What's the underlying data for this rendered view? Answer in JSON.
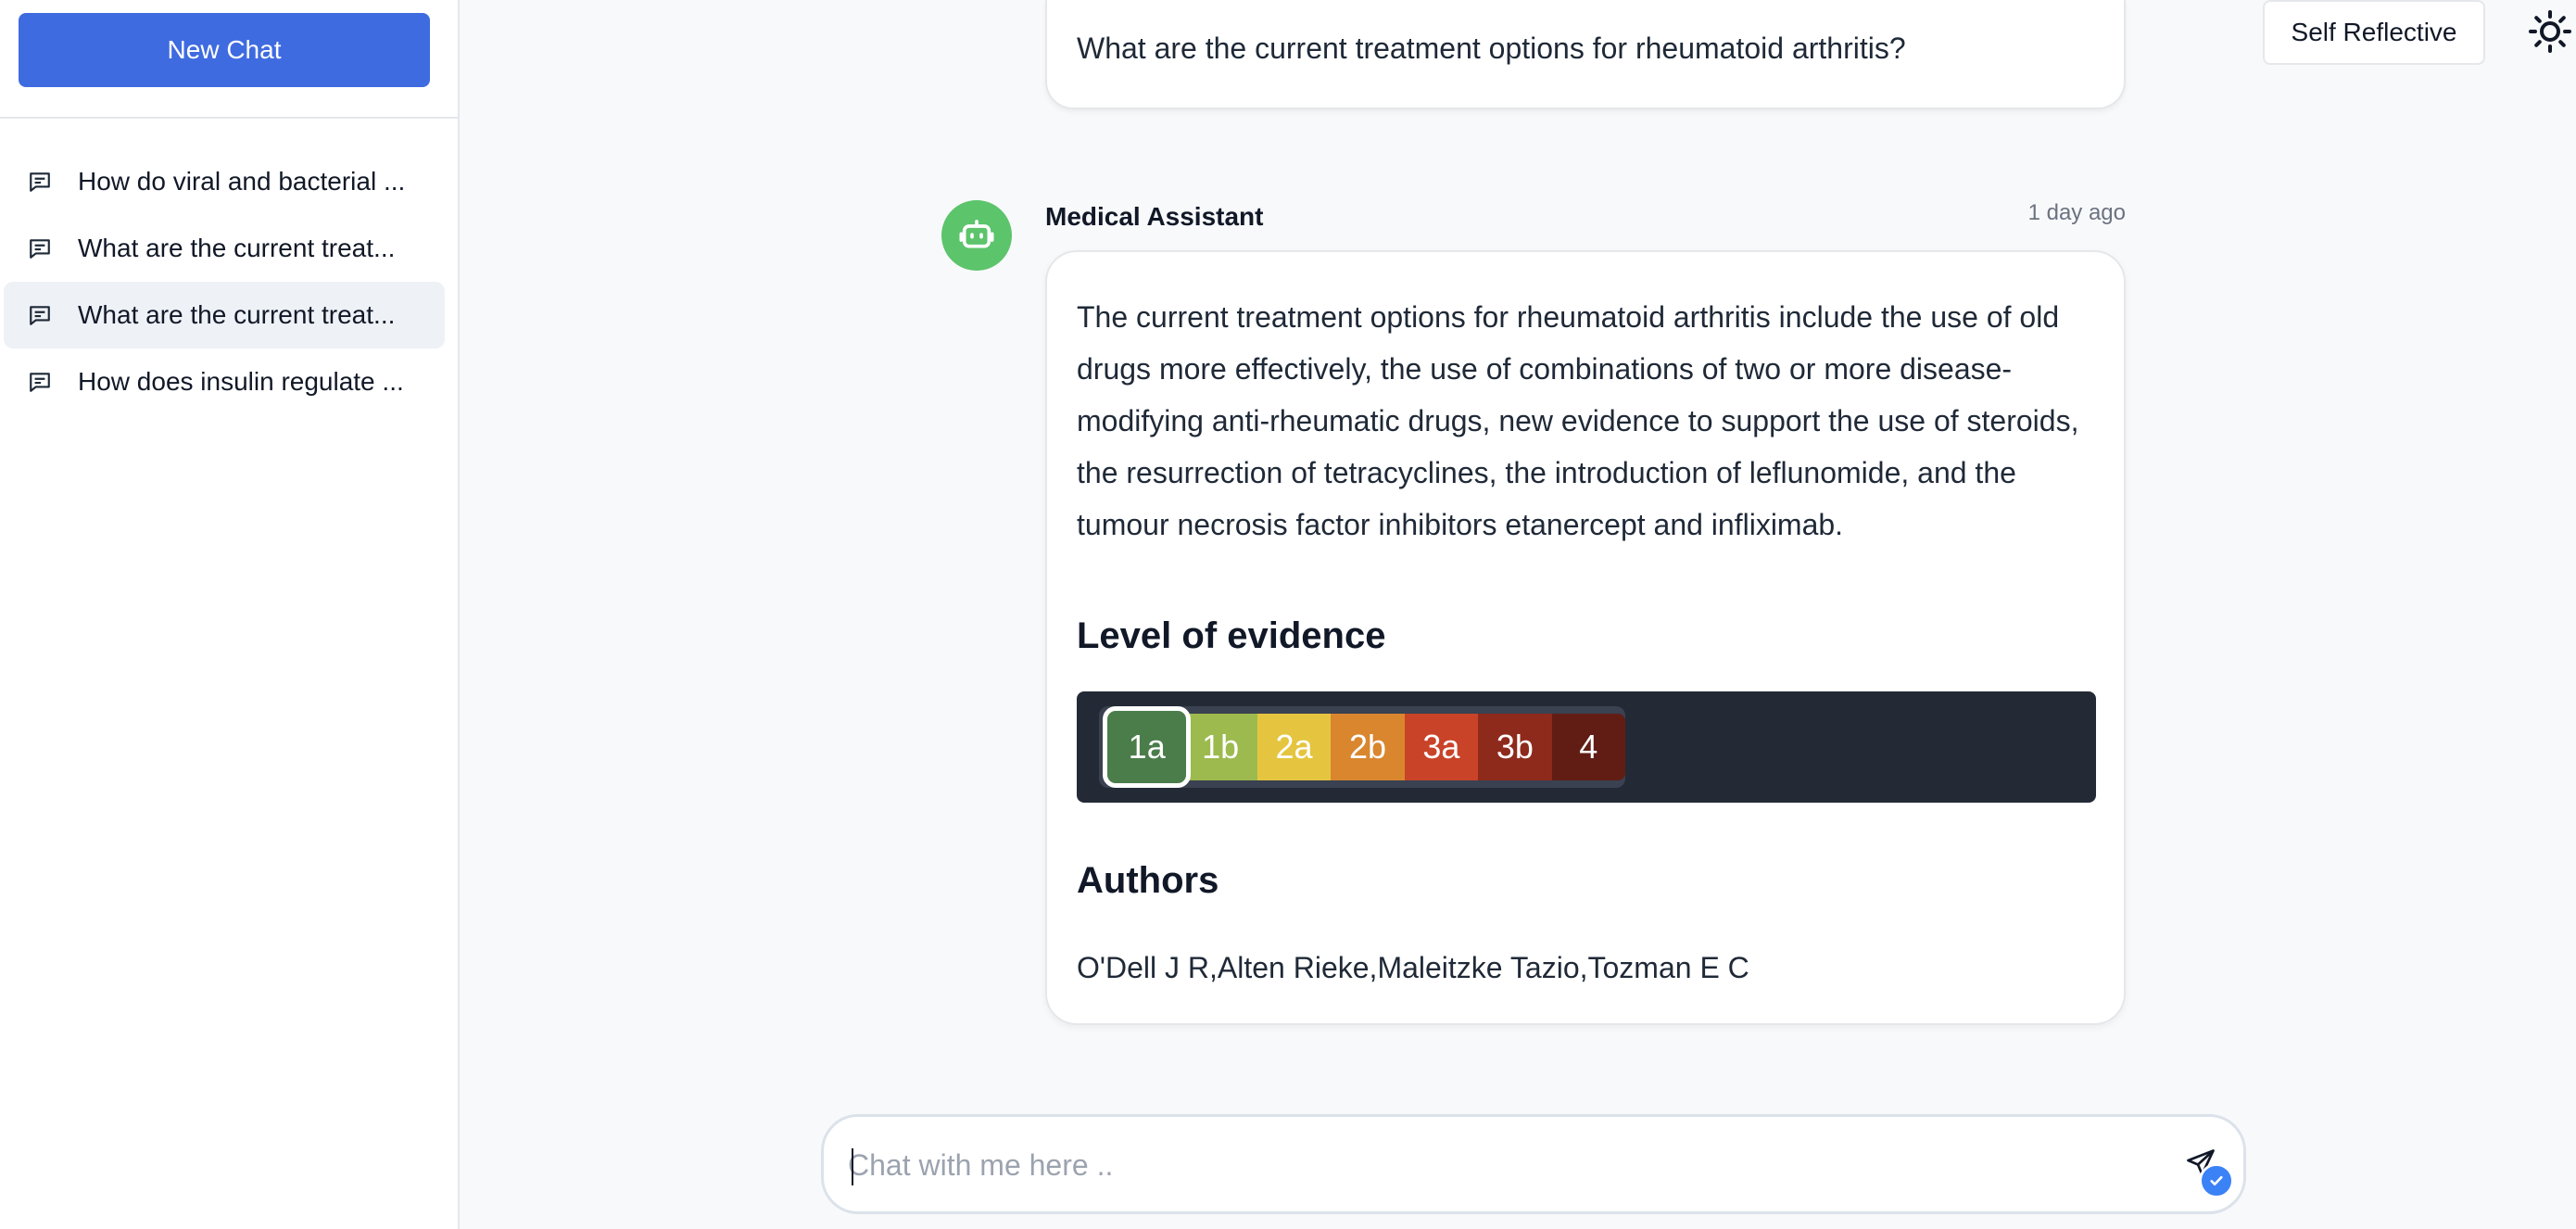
{
  "sidebar": {
    "new_chat_label": "New Chat",
    "history": [
      {
        "title": "How do viral and bacterial ...",
        "icon": "chat-bubble-icon"
      },
      {
        "title": "What are the current treat...",
        "icon": "chat-bubble-icon"
      },
      {
        "title": "What are the current treat...",
        "icon": "chat-bubble-icon",
        "active": true
      },
      {
        "title": "How does insulin regulate ...",
        "icon": "chat-bubble-icon"
      }
    ]
  },
  "header": {
    "mode_label": "Self Reflective",
    "theme_icon": "sun-icon"
  },
  "conversation": {
    "user_question": "What are the current treatment options for rheumatoid arthritis?",
    "assistant": {
      "name": "Medical Assistant",
      "avatar_icon": "robot-icon",
      "timestamp": "1 day ago",
      "answer": "The current treatment options for rheumatoid arthritis include the use of old drugs more effectively, the use of combinations of two or more disease-modifying anti-rheumatic drugs, new evidence to support the use of steroids, the resurrection of tetracyclines, the introduction of leflunomide, and the tumour necrosis factor inhibitors etanercept and infliximab.",
      "evidence_heading": "Level of evidence",
      "evidence_levels": [
        {
          "label": "1a",
          "color": "#4a7d4a"
        },
        {
          "label": "1b",
          "color": "#9cba4e"
        },
        {
          "label": "2a",
          "color": "#e5c53f"
        },
        {
          "label": "2b",
          "color": "#d9862f"
        },
        {
          "label": "3a",
          "color": "#c94328"
        },
        {
          "label": "3b",
          "color": "#8e2a1c"
        },
        {
          "label": "4",
          "color": "#611d14"
        }
      ],
      "selected_evidence": "1a",
      "authors_heading": "Authors",
      "authors": "O'Dell J R,Alten Rieke,Maleitzke Tazio,Tozman E C"
    }
  },
  "input": {
    "placeholder": "Chat with me here ..",
    "value": "",
    "send_icon": "send-icon"
  },
  "colors": {
    "primary": "#3f6be0",
    "avatar_bg": "#5cc46b",
    "evidence_bg": "#232a36"
  }
}
